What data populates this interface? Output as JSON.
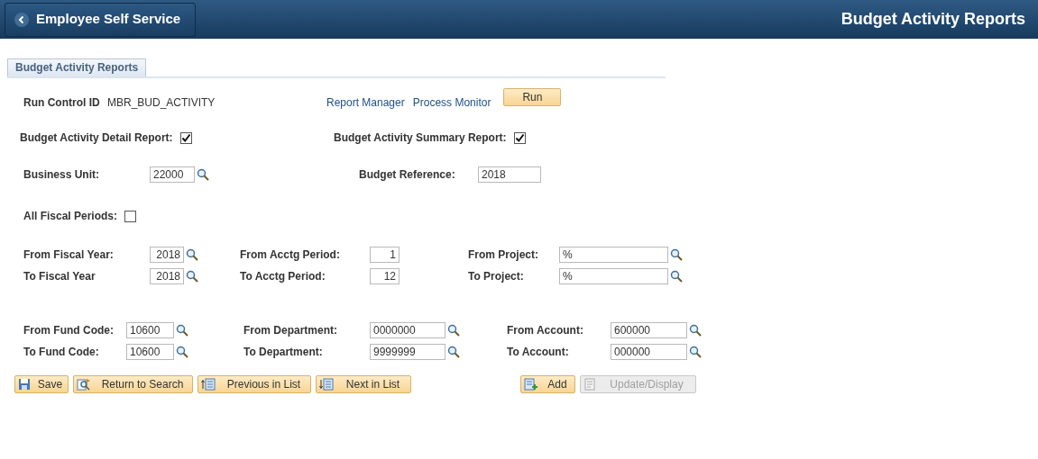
{
  "header": {
    "back_label": "Employee Self Service",
    "title": "Budget Activity Reports"
  },
  "tabs": [
    {
      "label": "Budget Activity Reports",
      "selected": true
    }
  ],
  "run_control": {
    "label": "Run Control ID",
    "value": "MBR_BUD_ACTIVITY"
  },
  "links": [
    "Report Manager",
    "Process Monitor"
  ],
  "run_button": "Run",
  "report_options": [
    {
      "label": "Budget Activity Detail Report:",
      "checked": true
    },
    {
      "label": "Budget Activity Summary Report:",
      "checked": true
    }
  ],
  "business_unit": {
    "label": "Business Unit:",
    "value": "22000",
    "lookup": true
  },
  "budget_reference": {
    "label": "Budget Reference:",
    "value": "2018",
    "lookup": false
  },
  "all_fiscal_periods": {
    "label": "All Fiscal Periods:",
    "checked": false
  },
  "range_blocks": [
    {
      "columns": [
        {
          "fields": [
            {
              "label": "From Fiscal Year:",
              "value": "2018",
              "kind": "number",
              "lookup": true
            },
            {
              "label": "To Fiscal Year",
              "value": "2018",
              "kind": "number",
              "lookup": true
            }
          ]
        },
        {
          "fields": [
            {
              "label": "From Acctg Period:",
              "value": "1",
              "kind": "number",
              "lookup": false
            },
            {
              "label": "To Acctg Period:",
              "value": "12",
              "kind": "number",
              "lookup": false
            }
          ]
        },
        {
          "fields": [
            {
              "label": "From Project:",
              "value": "%",
              "kind": "text",
              "lookup": true
            },
            {
              "label": "To Project:",
              "value": "%",
              "kind": "text",
              "lookup": true
            }
          ]
        }
      ]
    },
    {
      "columns": [
        {
          "fields": [
            {
              "label": "From Fund Code:",
              "value": "10600",
              "kind": "text",
              "lookup": true
            },
            {
              "label": "To Fund Code:",
              "value": "10600",
              "kind": "text",
              "lookup": true
            }
          ]
        },
        {
          "fields": [
            {
              "label": "From Department:",
              "value": "0000000",
              "kind": "text",
              "lookup": true
            },
            {
              "label": "To Department:",
              "value": "9999999",
              "kind": "text",
              "lookup": true
            }
          ]
        },
        {
          "fields": [
            {
              "label": "From Account:",
              "value": "600000",
              "kind": "text",
              "lookup": true
            },
            {
              "label": "To Account:",
              "value": "000000",
              "kind": "text",
              "lookup": true
            }
          ]
        }
      ]
    }
  ],
  "toolbar_left": [
    {
      "label": "Save",
      "kind": "save",
      "disabled": false
    },
    {
      "label": "Return to Search",
      "kind": "return",
      "disabled": false
    },
    {
      "label": "Previous in List",
      "kind": "previous",
      "disabled": false
    },
    {
      "label": "Next in List",
      "kind": "next",
      "disabled": false
    }
  ],
  "toolbar_right": [
    {
      "label": "Add",
      "kind": "add",
      "disabled": false
    },
    {
      "label": "Update/Display",
      "kind": "update",
      "disabled": true
    }
  ]
}
